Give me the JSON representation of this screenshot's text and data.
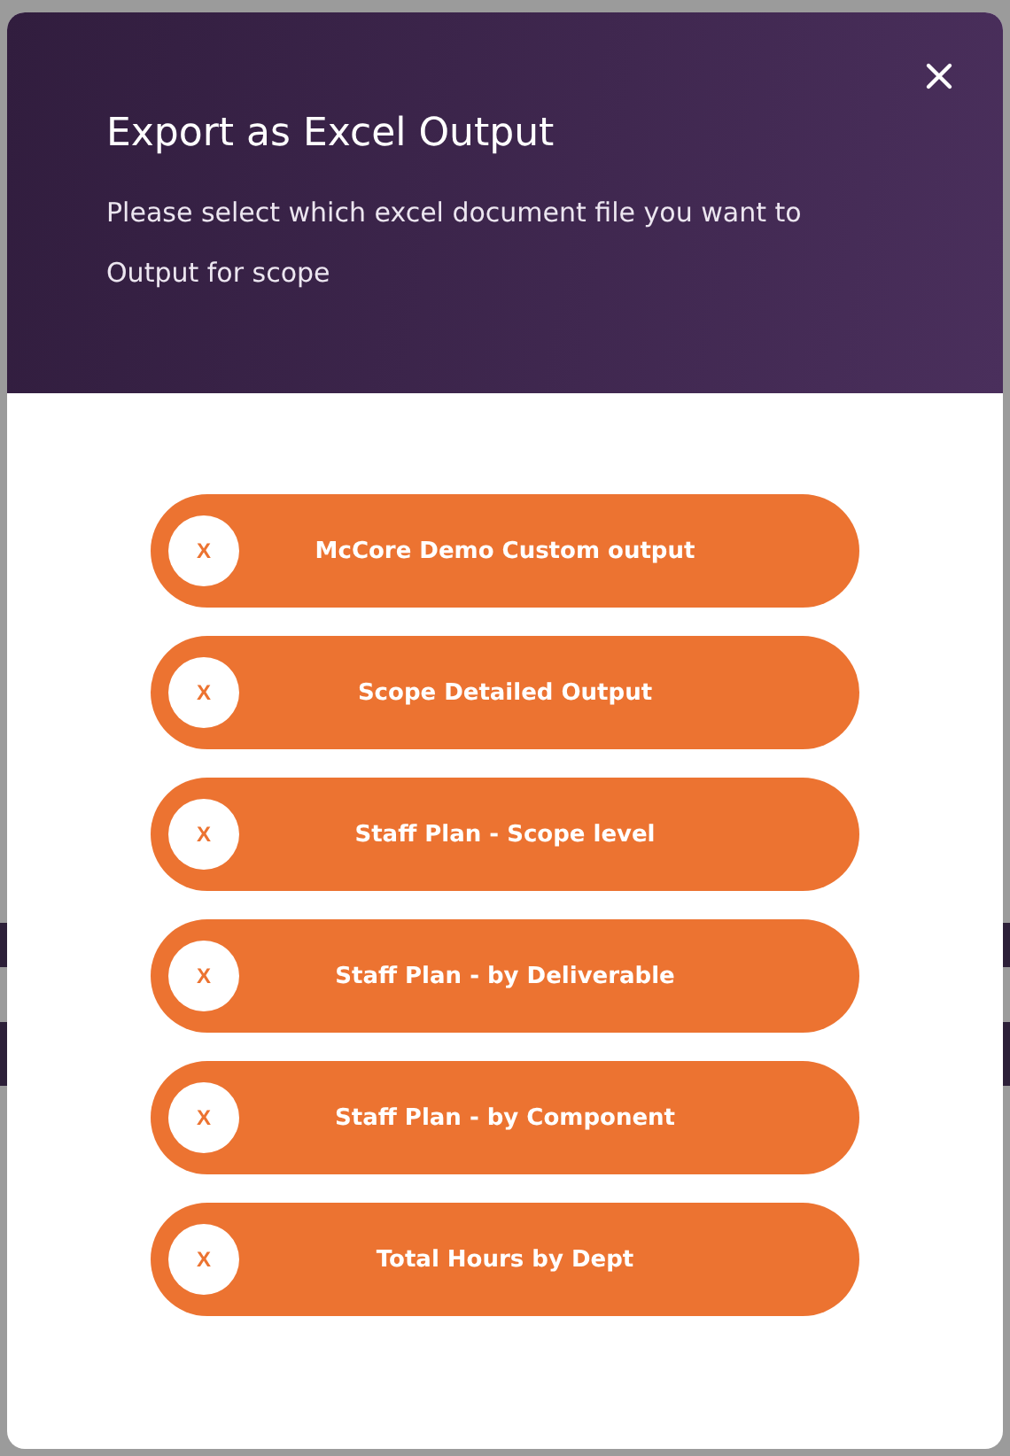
{
  "dialog": {
    "title": "Export as Excel Output",
    "subtitle": "Please select which excel document file you want to Output for scope",
    "options": [
      {
        "label": "McCore Demo Custom output",
        "marker": "X"
      },
      {
        "label": "Scope Detailed Output",
        "marker": "X"
      },
      {
        "label": "Staff Plan - Scope level",
        "marker": "X"
      },
      {
        "label": "Staff Plan - by Deliverable",
        "marker": "X"
      },
      {
        "label": "Staff Plan - by Component",
        "marker": "X"
      },
      {
        "label": "Total Hours by Dept",
        "marker": "X"
      }
    ]
  }
}
